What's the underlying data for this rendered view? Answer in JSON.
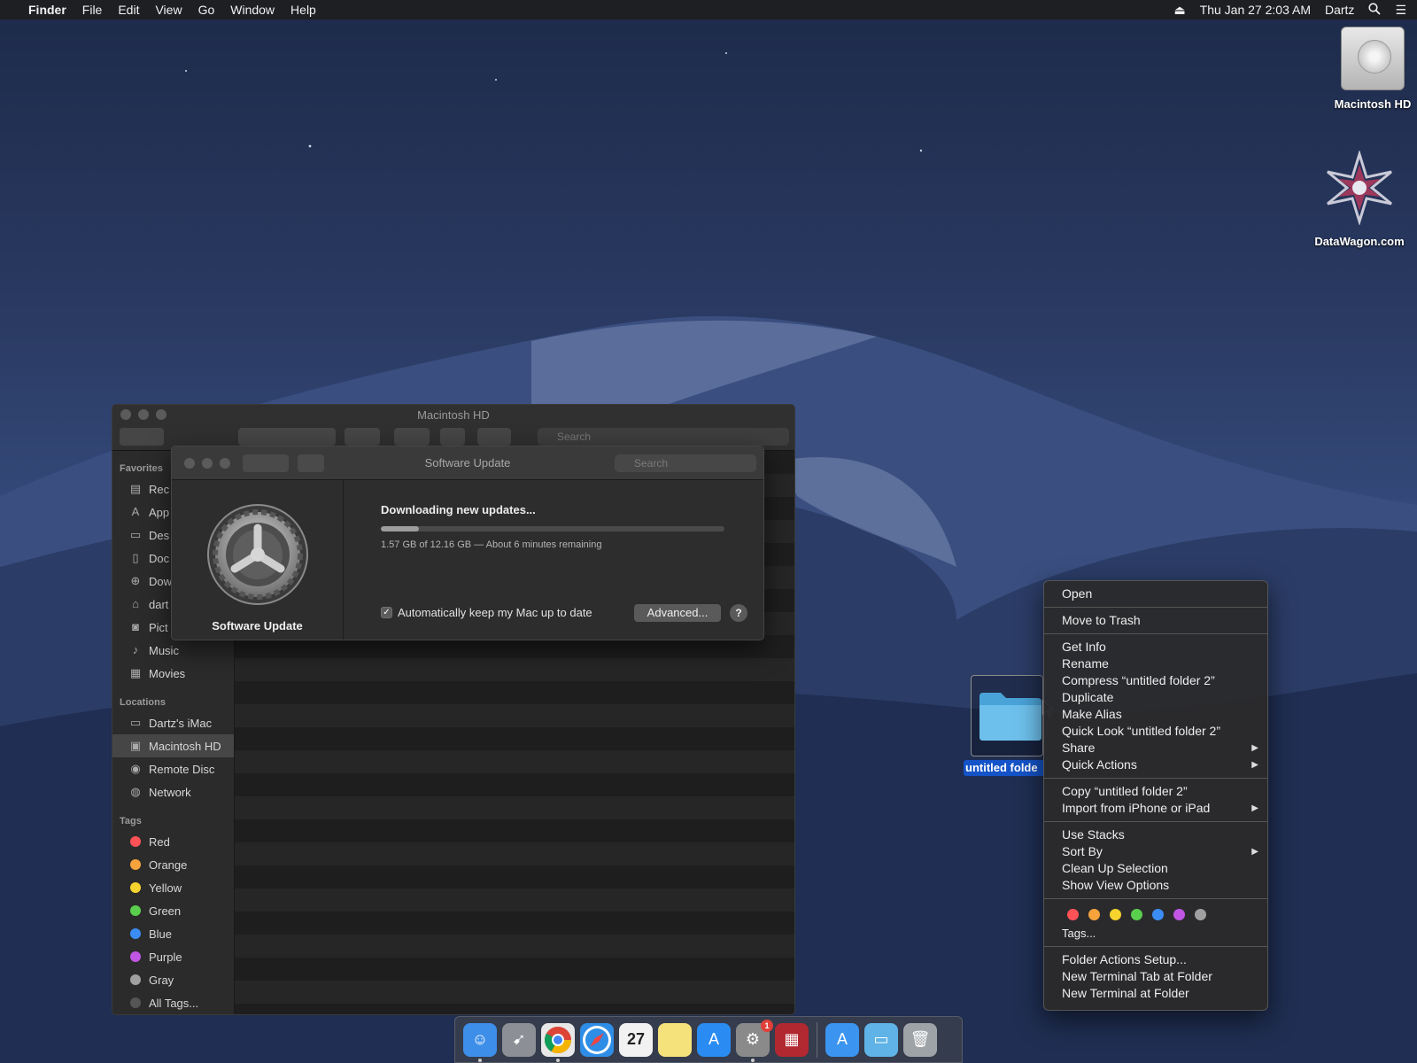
{
  "menubar": {
    "app_name": "Finder",
    "menus": [
      "File",
      "Edit",
      "View",
      "Go",
      "Window",
      "Help"
    ],
    "clock": "Thu Jan 27  2:03 AM",
    "user": "Dartz"
  },
  "desktop": {
    "icons": [
      {
        "label": "Macintosh HD"
      },
      {
        "label": "DataWagon.com"
      }
    ],
    "selected_folder_label": "untitled folde"
  },
  "finder_window": {
    "title": "Macintosh HD",
    "search_placeholder": "Search",
    "sidebar": {
      "favorites_heading": "Favorites",
      "favorites": [
        {
          "label": "Rec",
          "icon": "recents-icon"
        },
        {
          "label": "App",
          "icon": "applications-icon"
        },
        {
          "label": "Des",
          "icon": "desktop-icon"
        },
        {
          "label": "Doc",
          "icon": "documents-icon"
        },
        {
          "label": "Dow",
          "icon": "downloads-icon"
        },
        {
          "label": "dart",
          "icon": "home-icon"
        },
        {
          "label": "Pict",
          "icon": "pictures-icon"
        },
        {
          "label": "Music",
          "icon": "music-icon"
        },
        {
          "label": "Movies",
          "icon": "movies-icon"
        }
      ],
      "locations_heading": "Locations",
      "locations": [
        {
          "label": "Dartz's iMac",
          "icon": "imac-icon"
        },
        {
          "label": "Macintosh HD",
          "icon": "disk-icon",
          "selected": true
        },
        {
          "label": "Remote Disc",
          "icon": "disc-icon"
        },
        {
          "label": "Network",
          "icon": "network-icon"
        }
      ],
      "tags_heading": "Tags",
      "tags": [
        {
          "label": "Red",
          "color": "#ff5257"
        },
        {
          "label": "Orange",
          "color": "#f7a33c"
        },
        {
          "label": "Yellow",
          "color": "#f6d32d"
        },
        {
          "label": "Green",
          "color": "#59cf4d"
        },
        {
          "label": "Blue",
          "color": "#3b8df5"
        },
        {
          "label": "Purple",
          "color": "#c156e5"
        },
        {
          "label": "Gray",
          "color": "#a0a0a0"
        },
        {
          "label": "All Tags...",
          "color": "#555555"
        }
      ]
    }
  },
  "software_update": {
    "title": "Software Update",
    "search_placeholder": "Search",
    "pane_name": "Software Update",
    "status": "Downloading new updates...",
    "progress_fraction": 0.11,
    "detail": "1.57 GB of 12.16 GB — About 6 minutes remaining",
    "auto_update_label": "Automatically keep my Mac up to date",
    "auto_update_checked": true,
    "advanced_label": "Advanced...",
    "help_label": "?"
  },
  "context_menu": {
    "groups": [
      [
        {
          "label": "Open"
        }
      ],
      [
        {
          "label": "Move to Trash"
        }
      ],
      [
        {
          "label": "Get Info"
        },
        {
          "label": "Rename"
        },
        {
          "label": "Compress “untitled folder 2”"
        },
        {
          "label": "Duplicate"
        },
        {
          "label": "Make Alias"
        },
        {
          "label": "Quick Look “untitled folder 2”"
        },
        {
          "label": "Share",
          "submenu": true
        },
        {
          "label": "Quick Actions",
          "submenu": true
        }
      ],
      [
        {
          "label": "Copy “untitled folder 2”"
        },
        {
          "label": "Import from iPhone or iPad",
          "submenu": true
        }
      ],
      [
        {
          "label": "Use Stacks"
        },
        {
          "label": "Sort By",
          "submenu": true
        },
        {
          "label": "Clean Up Selection"
        },
        {
          "label": "Show View Options"
        }
      ]
    ],
    "tag_colors": [
      "#ff5257",
      "#f7a33c",
      "#f6d32d",
      "#59cf4d",
      "#3b8df5",
      "#c156e5",
      "#a0a0a0"
    ],
    "tags_label": "Tags...",
    "footer": [
      {
        "label": "Folder Actions Setup..."
      },
      {
        "label": "New Terminal Tab at Folder"
      },
      {
        "label": "New Terminal at Folder"
      }
    ]
  },
  "dock": {
    "apps": [
      {
        "name": "finder-icon",
        "color": "#3d8ee8",
        "running": true
      },
      {
        "name": "launchpad-icon",
        "color": "#8c8f96",
        "running": false
      },
      {
        "name": "chrome-icon",
        "color": "#e8e8e8",
        "running": true
      },
      {
        "name": "safari-icon",
        "color": "#2e8de6",
        "running": false
      },
      {
        "name": "calendar-icon",
        "color": "#f2f2f2",
        "running": false,
        "text": "27"
      },
      {
        "name": "notes-icon",
        "color": "#f6e27a",
        "running": false
      },
      {
        "name": "app-store-icon",
        "color": "#2a8cf2",
        "running": false
      },
      {
        "name": "system-preferences-icon",
        "color": "#8a8a8a",
        "running": true,
        "badge": "1"
      },
      {
        "name": "photo-booth-icon",
        "color": "#b22830",
        "running": false
      }
    ],
    "right_apps": [
      {
        "name": "app-store-downloads-icon",
        "color": "#3a94f0"
      },
      {
        "name": "downloads-folder-icon",
        "color": "#5fb3e6"
      },
      {
        "name": "trash-icon",
        "color": "#9ea3a8"
      }
    ]
  }
}
